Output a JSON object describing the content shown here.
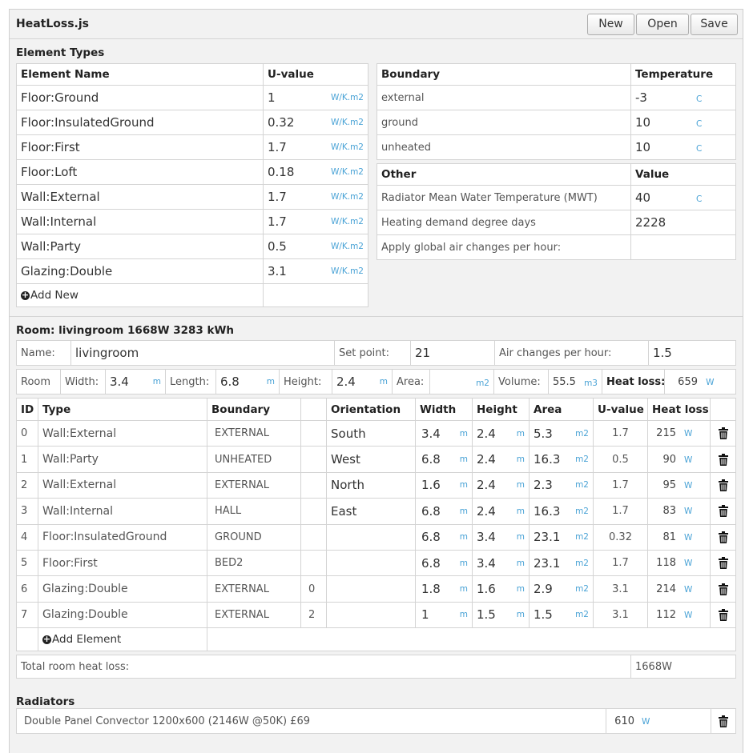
{
  "app": {
    "title": "HeatLoss.js",
    "buttons": {
      "new": "New",
      "open": "Open",
      "save": "Save"
    }
  },
  "element_types": {
    "heading": "Element Types",
    "col_name": "Element Name",
    "col_uvalue": "U-value",
    "unit": "W/K.m2",
    "rows": [
      {
        "name": "Floor:Ground",
        "u": "1"
      },
      {
        "name": "Floor:InsulatedGround",
        "u": "0.32"
      },
      {
        "name": "Floor:First",
        "u": "1.7"
      },
      {
        "name": "Floor:Loft",
        "u": "0.18"
      },
      {
        "name": "Wall:External",
        "u": "1.7"
      },
      {
        "name": "Wall:Internal",
        "u": "1.7"
      },
      {
        "name": "Wall:Party",
        "u": "0.5"
      },
      {
        "name": "Glazing:Double",
        "u": "3.1"
      }
    ],
    "add_new": "Add New"
  },
  "boundaries": {
    "col_boundary": "Boundary",
    "col_temp": "Temperature",
    "unit": "C",
    "rows": [
      {
        "name": "external",
        "temp": "-3"
      },
      {
        "name": "ground",
        "temp": "10"
      },
      {
        "name": "unheated",
        "temp": "10"
      }
    ]
  },
  "other": {
    "col_other": "Other",
    "col_value": "Value",
    "rows": [
      {
        "name": "Radiator Mean Water Temperature (MWT)",
        "value": "40",
        "unit": "C"
      },
      {
        "name": "Heating demand degree days",
        "value": "2228",
        "unit": ""
      },
      {
        "name": "Apply global air changes per hour:",
        "value": "",
        "unit": ""
      }
    ]
  },
  "room": {
    "heading": "Room: livingroom 1668W 3283 kWh",
    "name_label": "Name:",
    "name": "livingroom",
    "setpoint_label": "Set point:",
    "setpoint": "21",
    "ach_label": "Air changes per hour:",
    "ach": "1.5",
    "dims": {
      "room_label": "Room",
      "width_label": "Width:",
      "width": "3.4",
      "length_label": "Length:",
      "length": "6.8",
      "height_label": "Height:",
      "height": "2.4",
      "area_label": "Area:",
      "area": "",
      "volume_label": "Volume:",
      "volume": "55.5",
      "heatloss_label": "Heat loss:",
      "heatloss": "659",
      "unit_m": "m",
      "unit_m2": "m2",
      "unit_m3": "m3",
      "unit_w": "W"
    },
    "columns": {
      "id": "ID",
      "type": "Type",
      "boundary": "Boundary",
      "extra": "",
      "orientation": "Orientation",
      "width": "Width",
      "height": "Height",
      "area": "Area",
      "uvalue": "U-value",
      "heatloss": "Heat loss"
    },
    "elements": [
      {
        "id": "0",
        "type": "Wall:External",
        "boundary": "EXTERNAL",
        "extra": "",
        "orientation": "South",
        "width": "3.4",
        "height": "2.4",
        "area": "5.3",
        "u": "1.7",
        "loss": "215"
      },
      {
        "id": "1",
        "type": "Wall:Party",
        "boundary": "UNHEATED",
        "extra": "",
        "orientation": "West",
        "width": "6.8",
        "height": "2.4",
        "area": "16.3",
        "u": "0.5",
        "loss": "90"
      },
      {
        "id": "2",
        "type": "Wall:External",
        "boundary": "EXTERNAL",
        "extra": "",
        "orientation": "North",
        "width": "1.6",
        "height": "2.4",
        "area": "2.3",
        "u": "1.7",
        "loss": "95"
      },
      {
        "id": "3",
        "type": "Wall:Internal",
        "boundary": "HALL",
        "extra": "",
        "orientation": "East",
        "width": "6.8",
        "height": "2.4",
        "area": "16.3",
        "u": "1.7",
        "loss": "83"
      },
      {
        "id": "4",
        "type": "Floor:InsulatedGround",
        "boundary": "GROUND",
        "extra": "",
        "orientation": "",
        "width": "6.8",
        "height": "3.4",
        "area": "23.1",
        "u": "0.32",
        "loss": "81"
      },
      {
        "id": "5",
        "type": "Floor:First",
        "boundary": "BED2",
        "extra": "",
        "orientation": "",
        "width": "6.8",
        "height": "3.4",
        "area": "23.1",
        "u": "1.7",
        "loss": "118"
      },
      {
        "id": "6",
        "type": "Glazing:Double",
        "boundary": "EXTERNAL",
        "extra": "0",
        "orientation": "",
        "width": "1.8",
        "height": "1.6",
        "area": "2.9",
        "u": "3.1",
        "loss": "214"
      },
      {
        "id": "7",
        "type": "Glazing:Double",
        "boundary": "EXTERNAL",
        "extra": "2",
        "orientation": "",
        "width": "1",
        "height": "1.5",
        "area": "1.5",
        "u": "3.1",
        "loss": "112"
      }
    ],
    "add_element": "Add Element",
    "total_label": "Total room heat loss:",
    "total": "1668W"
  },
  "radiators": {
    "heading": "Radiators",
    "items": [
      {
        "name": "Double Panel Convector 1200x600 (2146W @50K) £69",
        "output": "610"
      }
    ]
  },
  "icons": {
    "trash": "trash-icon",
    "plus": "plus-circle-icon"
  }
}
